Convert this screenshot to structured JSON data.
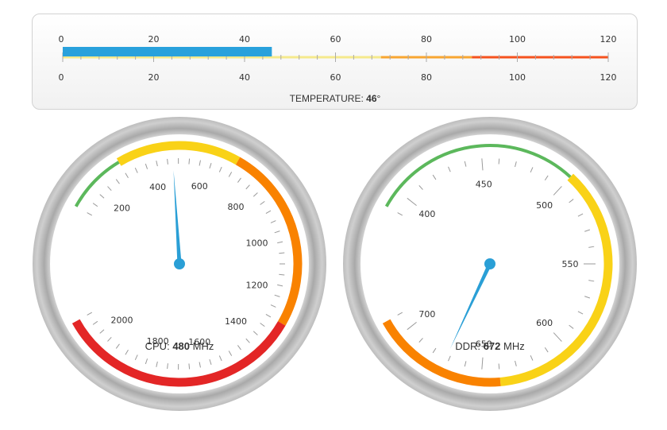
{
  "chart_data": [
    {
      "type": "linear-gauge",
      "name_label": "TEMPERATURE:",
      "value": 46,
      "unit_symbol": "°",
      "range": [
        0,
        120
      ],
      "major_ticks": [
        "0",
        "20",
        "40",
        "60",
        "80",
        "100",
        "120"
      ],
      "minor_per_major": 5,
      "bands": [
        {
          "from": 0,
          "to": 70,
          "color": "#f5e98c"
        },
        {
          "from": 70,
          "to": 90,
          "color": "#f8a632"
        },
        {
          "from": 90,
          "to": 120,
          "color": "#f5531f"
        }
      ],
      "bar_color": "#29a1dc"
    },
    {
      "type": "radial-gauge",
      "name_label": "CPU:",
      "value": 480,
      "unit": "MHz",
      "range": [
        100,
        2100
      ],
      "tick_labels": [
        "200",
        "400",
        "600",
        "800",
        "1000",
        "1200",
        "1400",
        "1600",
        "1800",
        "2000"
      ],
      "bands": [
        {
          "from": 100,
          "to": 300,
          "color": "#5cb85c"
        },
        {
          "from": 300,
          "to": 700,
          "color": "#f9d217"
        },
        {
          "from": 700,
          "to": 1300,
          "color": "#f98200"
        },
        {
          "from": 1300,
          "to": 2100,
          "color": "#e32626"
        }
      ],
      "needle_color": "#2a9fd6"
    },
    {
      "type": "radial-gauge",
      "name_label": "DDR:",
      "value": 672,
      "unit": "MHz",
      "range": [
        390,
        710
      ],
      "tick_labels": [
        "400",
        "450",
        "500",
        "550",
        "600",
        "650",
        "700"
      ],
      "bands": [
        {
          "from": 390,
          "to": 500,
          "color": "#5cb85c"
        },
        {
          "from": 500,
          "to": 640,
          "color": "#f9d217"
        },
        {
          "from": 640,
          "to": 710,
          "color": "#f98200"
        }
      ],
      "needle_color": "#2a9fd6"
    }
  ]
}
